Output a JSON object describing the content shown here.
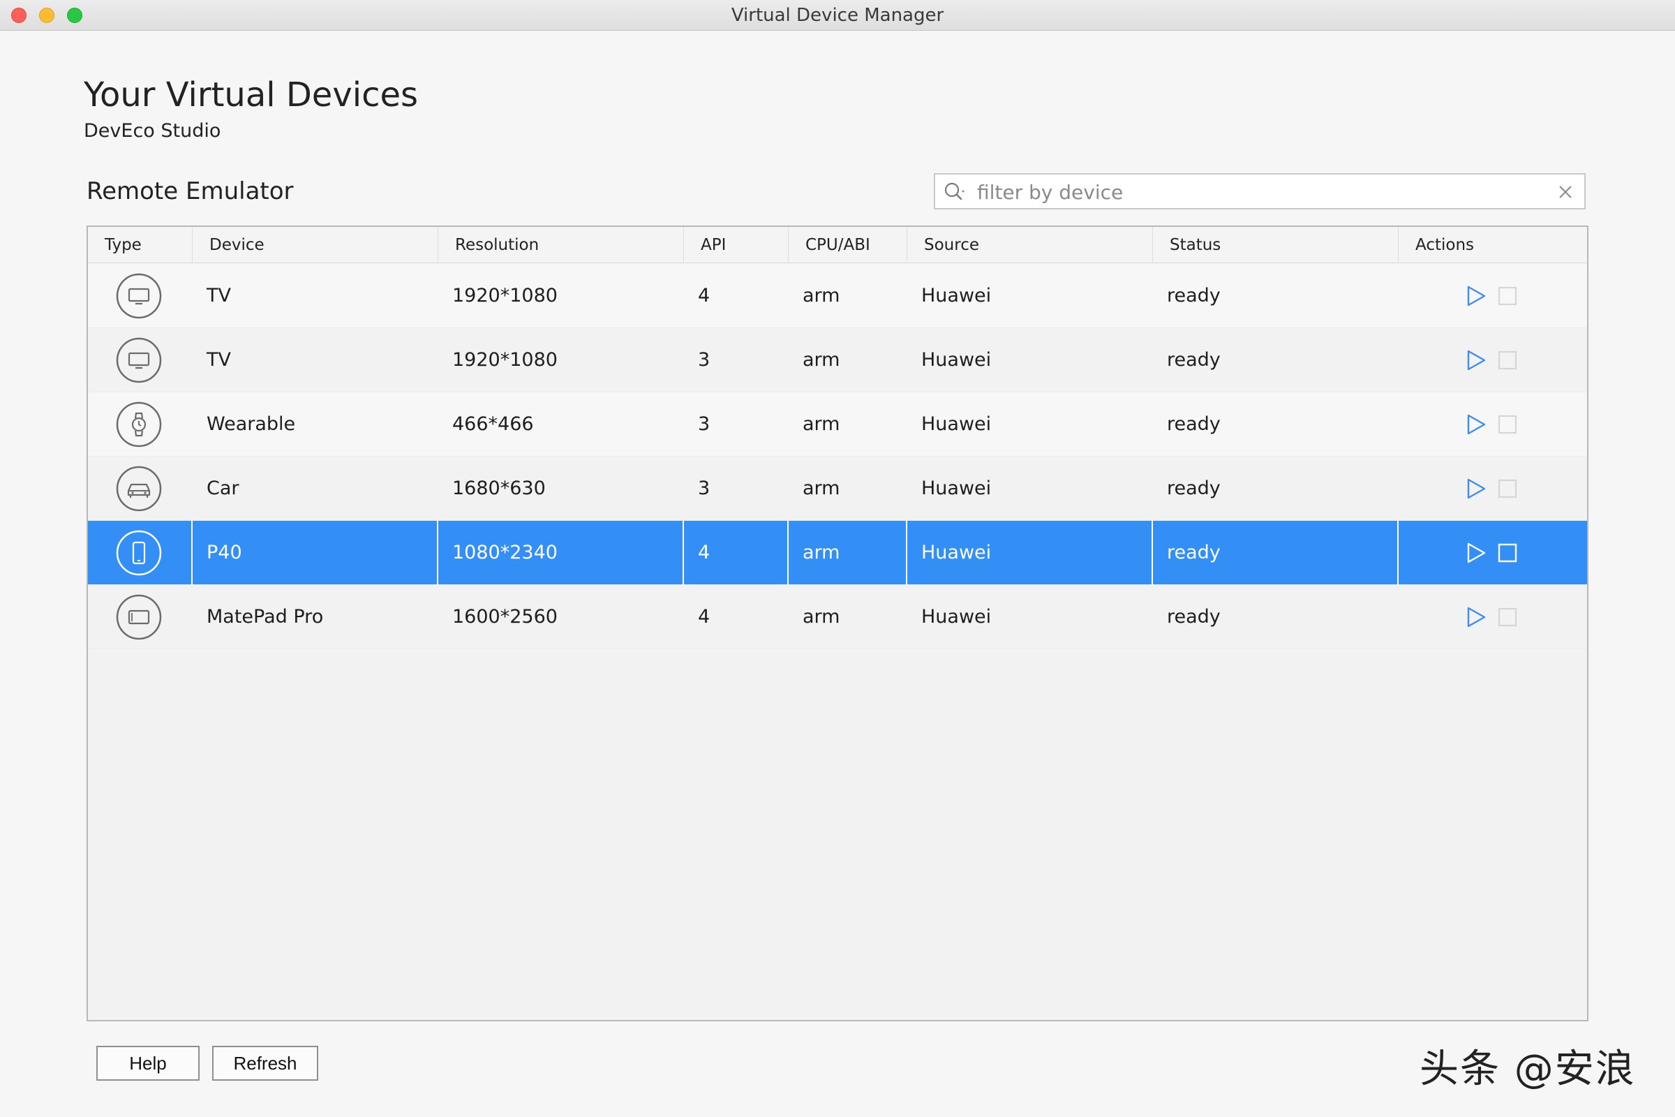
{
  "window": {
    "title": "Virtual Device Manager"
  },
  "header": {
    "title": "Your Virtual Devices",
    "subtitle": "DevEco Studio"
  },
  "section": {
    "title": "Remote Emulator"
  },
  "search": {
    "placeholder": "filter by device",
    "value": ""
  },
  "table": {
    "columns": [
      "Type",
      "Device",
      "Resolution",
      "API",
      "CPU/ABI",
      "Source",
      "Status",
      "Actions"
    ],
    "rows": [
      {
        "type_icon": "tv-icon",
        "device": "TV",
        "resolution": "1920*1080",
        "api": "4",
        "cpu": "arm",
        "source": "Huawei",
        "status": "ready"
      },
      {
        "type_icon": "tv-icon",
        "device": "TV",
        "resolution": "1920*1080",
        "api": "3",
        "cpu": "arm",
        "source": "Huawei",
        "status": "ready"
      },
      {
        "type_icon": "watch-icon",
        "device": "Wearable",
        "resolution": "466*466",
        "api": "3",
        "cpu": "arm",
        "source": "Huawei",
        "status": "ready"
      },
      {
        "type_icon": "car-icon",
        "device": "Car",
        "resolution": "1680*630",
        "api": "3",
        "cpu": "arm",
        "source": "Huawei",
        "status": "ready"
      },
      {
        "type_icon": "phone-icon",
        "device": "P40",
        "resolution": "1080*2340",
        "api": "4",
        "cpu": "arm",
        "source": "Huawei",
        "status": "ready"
      },
      {
        "type_icon": "tablet-icon",
        "device": "MatePad Pro",
        "resolution": "1600*2560",
        "api": "4",
        "cpu": "arm",
        "source": "Huawei",
        "status": "ready"
      }
    ],
    "selected_index": 4
  },
  "buttons": {
    "help": "Help",
    "refresh": "Refresh"
  },
  "watermark": "头条 @安浪",
  "colors": {
    "selection": "#338ff6",
    "play_icon": "#3d8ef0",
    "stop_icon": "#d6d6d6"
  }
}
